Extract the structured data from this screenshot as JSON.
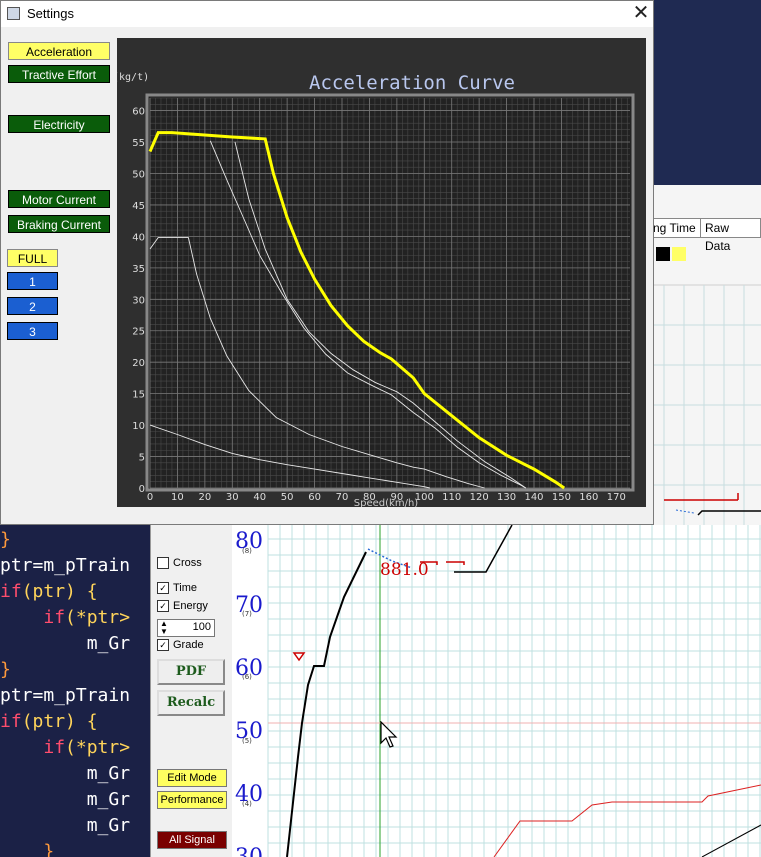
{
  "window": {
    "title": "Settings",
    "close_glyph": "✕"
  },
  "sidebar": {
    "mode_buttons": [
      {
        "label": "Acceleration",
        "style": "yellow"
      },
      {
        "label": "Tractive Effort",
        "style": "green"
      },
      {
        "label": "Electricity",
        "style": "green"
      },
      {
        "label": "Motor Current",
        "style": "green"
      },
      {
        "label": "Braking Current",
        "style": "green"
      }
    ],
    "notch_buttons": [
      {
        "label": "FULL",
        "style": "yellow"
      },
      {
        "label": "1",
        "style": "blue"
      },
      {
        "label": "2",
        "style": "blue"
      },
      {
        "label": "3",
        "style": "blue"
      }
    ]
  },
  "chart_data": {
    "type": "line",
    "title": "Acceleration Curve",
    "xlabel": "Speed(km/h)",
    "ylabel": "(kg/t)",
    "xlim": [
      0,
      175
    ],
    "ylim": [
      0,
      62
    ],
    "x_ticks": [
      0,
      10,
      20,
      30,
      40,
      50,
      60,
      70,
      80,
      90,
      100,
      110,
      120,
      130,
      140,
      150,
      160,
      170
    ],
    "y_ticks": [
      0,
      5,
      10,
      15,
      20,
      25,
      30,
      35,
      40,
      45,
      50,
      55,
      60
    ],
    "grid": true,
    "series": [
      {
        "color": "#ffff00",
        "highlight": true,
        "points": [
          [
            0,
            53.5
          ],
          [
            3,
            56.5
          ],
          [
            8,
            56.5
          ],
          [
            30,
            55.8
          ],
          [
            42,
            55.5
          ],
          [
            45,
            50
          ],
          [
            50,
            43
          ],
          [
            55,
            37.5
          ],
          [
            60,
            33.2
          ],
          [
            66,
            29
          ],
          [
            72,
            25.8
          ],
          [
            78,
            23.3
          ],
          [
            84,
            21.5
          ],
          [
            88,
            20.5
          ],
          [
            96,
            17.5
          ],
          [
            100,
            15
          ],
          [
            110,
            11.5
          ],
          [
            120,
            8
          ],
          [
            130,
            5.2
          ],
          [
            140,
            3
          ],
          [
            148,
            0.9
          ],
          [
            151,
            0
          ]
        ]
      },
      {
        "color": "#e8e8e8",
        "points": [
          [
            22,
            55.2
          ],
          [
            28,
            49
          ],
          [
            34,
            43
          ],
          [
            40,
            37
          ],
          [
            48,
            31
          ],
          [
            56,
            25.5
          ],
          [
            64,
            21.3
          ],
          [
            72,
            18.3
          ],
          [
            80,
            16.5
          ],
          [
            88,
            14.8
          ],
          [
            96,
            12
          ],
          [
            104,
            9.5
          ],
          [
            112,
            6.5
          ],
          [
            120,
            4
          ],
          [
            128,
            2
          ],
          [
            135,
            0.5
          ],
          [
            137,
            0
          ]
        ]
      },
      {
        "color": "#e8e8e8",
        "points": [
          [
            31,
            55
          ],
          [
            36,
            46
          ],
          [
            42,
            38
          ],
          [
            50,
            30
          ],
          [
            58,
            24.8
          ],
          [
            66,
            21.4
          ],
          [
            74,
            18.8
          ],
          [
            82,
            16.8
          ],
          [
            90,
            15.3
          ],
          [
            96,
            13.5
          ],
          [
            104,
            10.5
          ],
          [
            112,
            7.5
          ],
          [
            122,
            4.2
          ],
          [
            132,
            1.5
          ],
          [
            137,
            0
          ]
        ]
      },
      {
        "color": "#e8e8e8",
        "points": [
          [
            0,
            38
          ],
          [
            3,
            39.8
          ],
          [
            14,
            39.8
          ],
          [
            17,
            34
          ],
          [
            22,
            27
          ],
          [
            28,
            21
          ],
          [
            36,
            15.5
          ],
          [
            46,
            11.2
          ],
          [
            58,
            8.5
          ],
          [
            70,
            6.6
          ],
          [
            80,
            5.3
          ],
          [
            90,
            4
          ],
          [
            96,
            3.3
          ],
          [
            100,
            3
          ],
          [
            108,
            1.8
          ],
          [
            116,
            0.7
          ],
          [
            122,
            0
          ]
        ]
      },
      {
        "color": "#e8e8e8",
        "points": [
          [
            0,
            10
          ],
          [
            10,
            8.5
          ],
          [
            20,
            6.9
          ],
          [
            30,
            5.5
          ],
          [
            40,
            4.5
          ],
          [
            50,
            3.7
          ],
          [
            60,
            3
          ],
          [
            70,
            2.3
          ],
          [
            80,
            1.6
          ],
          [
            90,
            0.9
          ],
          [
            100,
            0.2
          ],
          [
            102,
            0
          ]
        ]
      }
    ]
  },
  "background": {
    "tabs": [
      {
        "label": "ng Time"
      },
      {
        "label": "Raw Data"
      }
    ],
    "code_lines": [
      "}",
      "ptr=m_pTrain",
      "if(ptr) {",
      "    if(*ptr>",
      "        m_Gr",
      "}",
      "ptr=m_pTrain",
      "if(ptr) {",
      "    if(*ptr>",
      "        m_Gr",
      "        m_Gr",
      "        m_Gr",
      "    }"
    ],
    "controls": {
      "cross_label": "Cross",
      "time_label": "Time",
      "energy_label": "Energy",
      "spin_value": "100",
      "grade_label": "Grade",
      "pdf_label": "PDF",
      "recalc_label": "Recalc",
      "edit_mode_label": "Edit Mode",
      "performance_label": "Performance",
      "all_signal_label": "All Signal"
    },
    "plot": {
      "y_labels": [
        "80",
        "70",
        "60",
        "50",
        "40",
        "30"
      ],
      "small_marks": [
        "(8)",
        "(7)",
        "(6)",
        "(5)",
        "(4)"
      ],
      "annotation": "881.0"
    }
  },
  "colors": {
    "yellow_curve": "#ffff00",
    "blue_accent": "#1b5fd1",
    "green_btn": "#0a5c0a"
  }
}
